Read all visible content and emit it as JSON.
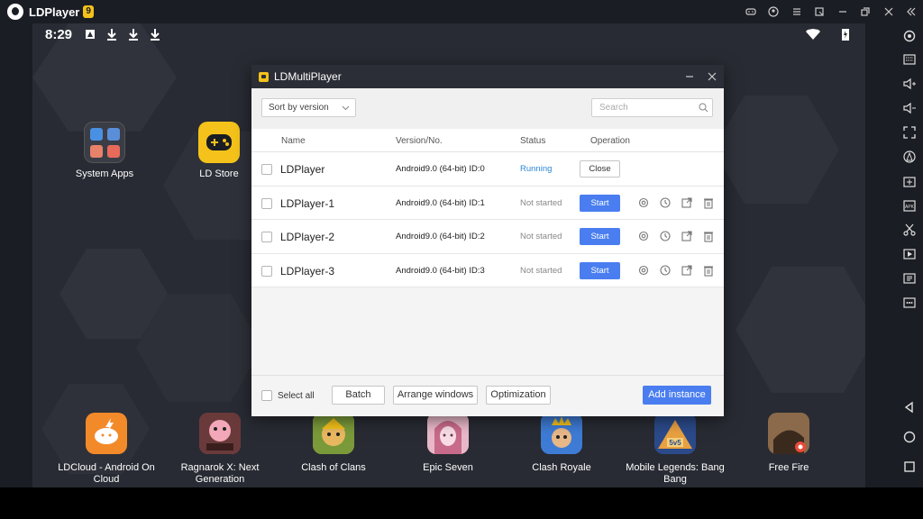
{
  "app": {
    "name": "LDPlayer",
    "version": "9"
  },
  "status_bar": {
    "time": "8:29"
  },
  "desktop_apps": [
    {
      "label": "System Apps",
      "icon": "system-apps-folder-icon"
    },
    {
      "label": "LD Store",
      "icon": "gamepad-icon"
    }
  ],
  "dock": [
    {
      "label": "LDCloud - Android On Cloud",
      "color": "#f28a2a"
    },
    {
      "label": "Ragnarok X: Next Generation",
      "color": "#c85b6a"
    },
    {
      "label": "Clash of Clans",
      "color": "#d9a53a"
    },
    {
      "label": "Epic Seven",
      "color": "#d79aa8"
    },
    {
      "label": "Clash Royale",
      "color": "#3e7bd4"
    },
    {
      "label": "Mobile Legends: Bang Bang",
      "color": "#2b4a8a"
    },
    {
      "label": "Free Fire",
      "color": "#6b4a2f"
    }
  ],
  "dialog": {
    "title": "LDMultiPlayer",
    "sort_label": "Sort by version",
    "search_placeholder": "Search",
    "columns": {
      "name": "Name",
      "version": "Version/No.",
      "status": "Status",
      "operation": "Operation"
    },
    "instances": [
      {
        "name": "LDPlayer",
        "version": "Android9.0 (64-bit) ID:0",
        "status": "Running",
        "action": "Close"
      },
      {
        "name": "LDPlayer-1",
        "version": "Android9.0 (64-bit) ID:1",
        "status": "Not started",
        "action": "Start"
      },
      {
        "name": "LDPlayer-2",
        "version": "Android9.0 (64-bit) ID:2",
        "status": "Not started",
        "action": "Start"
      },
      {
        "name": "LDPlayer-3",
        "version": "Android9.0 (64-bit) ID:3",
        "status": "Not started",
        "action": "Start"
      }
    ],
    "footer": {
      "select_all": "Select all",
      "batch": "Batch",
      "arrange": "Arrange windows",
      "optimization": "Optimization",
      "add_instance": "Add instance"
    }
  },
  "colors": {
    "accent": "#4a7ef0",
    "running": "#2f86d6",
    "brand_yellow": "#f4c21a"
  }
}
